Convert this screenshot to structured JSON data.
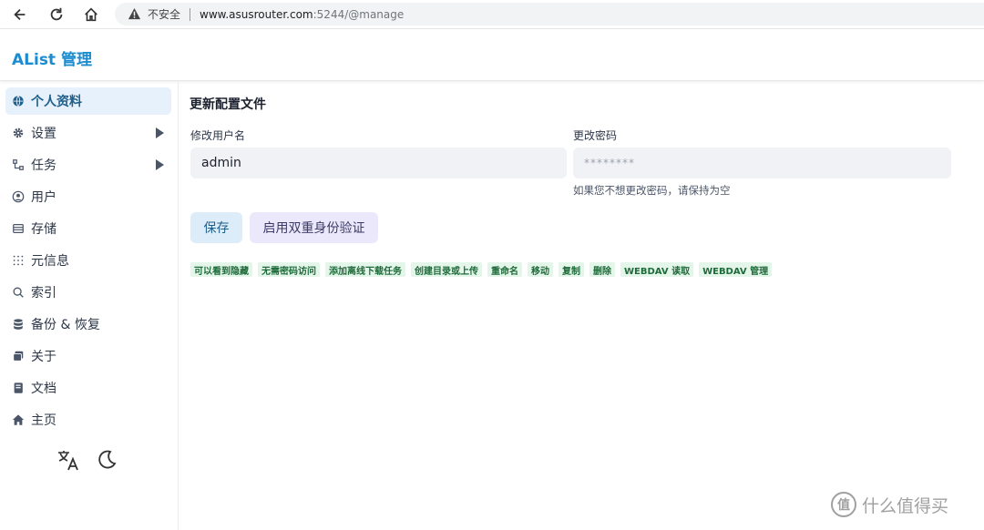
{
  "browser": {
    "insecure_label": "不安全",
    "url_host": "www.asusrouter.com",
    "url_path": ":5244/@manage"
  },
  "app": {
    "title": "AList 管理"
  },
  "sidebar": {
    "items": [
      {
        "label": "个人资料",
        "icon": "globe-icon"
      },
      {
        "label": "设置",
        "icon": "gear-icon"
      },
      {
        "label": "任务",
        "icon": "task-icon"
      },
      {
        "label": "用户",
        "icon": "user-icon"
      },
      {
        "label": "存储",
        "icon": "storage-icon"
      },
      {
        "label": "元信息",
        "icon": "meta-icon"
      },
      {
        "label": "索引",
        "icon": "search-icon"
      },
      {
        "label": "备份 & 恢复",
        "icon": "database-icon"
      },
      {
        "label": "关于",
        "icon": "about-icon"
      },
      {
        "label": "文档",
        "icon": "book-icon"
      },
      {
        "label": "主页",
        "icon": "home-icon"
      }
    ]
  },
  "main": {
    "section_title": "更新配置文件",
    "username_label": "修改用户名",
    "username_value": "admin",
    "password_label": "更改密码",
    "password_placeholder": "********",
    "password_hint": "如果您不想更改密码，请保持为空",
    "save_label": "保存",
    "twofa_label": "启用双重身份验证",
    "permissions": [
      "可以看到隐藏",
      "无需密码访问",
      "添加离线下载任务",
      "创建目录或上传",
      "重命名",
      "移动",
      "复制",
      "删除",
      "WEBDAV 读取",
      "WEBDAV 管理"
    ]
  },
  "watermark": {
    "text": "什么值得买",
    "logo_char": "值"
  },
  "colors": {
    "accent": "#1a8ccf",
    "active_bg": "#e6f1fb",
    "perm_bg": "#e4f5ea",
    "perm_text": "#1e6b3a"
  }
}
